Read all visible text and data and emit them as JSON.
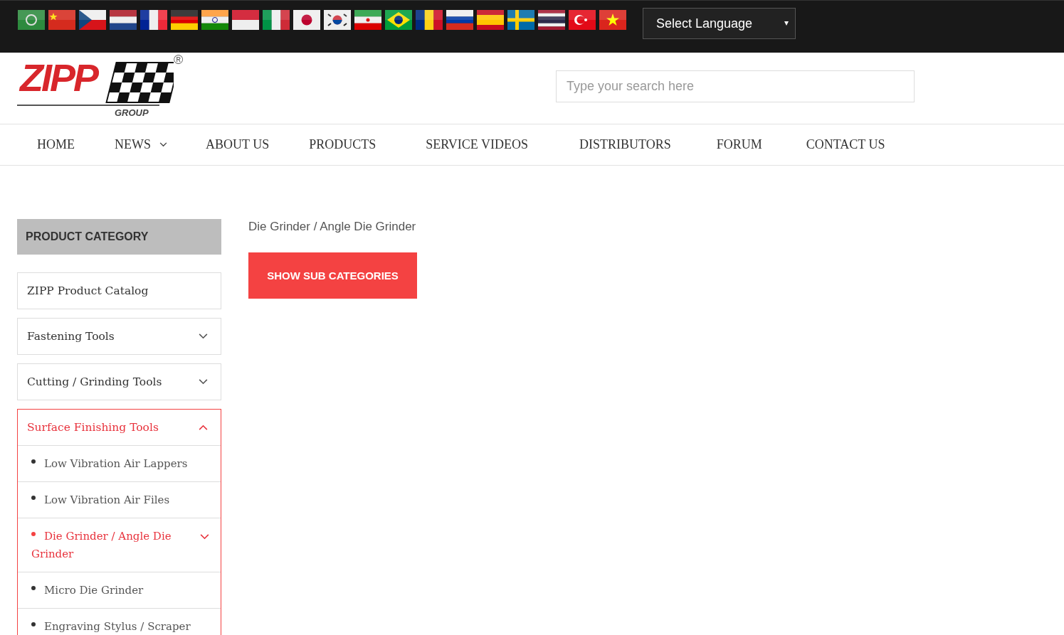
{
  "top_bar": {
    "flags": [
      {
        "kind": "arab"
      },
      {
        "kind": "china"
      },
      {
        "kind": "czech"
      },
      {
        "kind": "netherlands"
      },
      {
        "kind": "france"
      },
      {
        "kind": "germany"
      },
      {
        "kind": "india"
      },
      {
        "kind": "indonesia"
      },
      {
        "kind": "italy"
      },
      {
        "kind": "japan"
      },
      {
        "kind": "korea"
      },
      {
        "kind": "iran"
      },
      {
        "kind": "brazil"
      },
      {
        "kind": "romania"
      },
      {
        "kind": "russia"
      },
      {
        "kind": "spain"
      },
      {
        "kind": "sweden"
      },
      {
        "kind": "thailand"
      },
      {
        "kind": "turkey"
      },
      {
        "kind": "vietnam"
      }
    ],
    "language_select": {
      "value": "Select Language"
    }
  },
  "logo": {
    "wordmark": "ZIPP",
    "subtitle": "GROUP",
    "registered": "®"
  },
  "search": {
    "placeholder": "Type your search here"
  },
  "nav": [
    {
      "label": "HOME",
      "dropdown": false
    },
    {
      "label": "NEWS",
      "dropdown": true
    },
    {
      "label": "ABOUT US",
      "dropdown": false
    },
    {
      "label": "PRODUCTS",
      "dropdown": false
    },
    {
      "label": "SERVICE VIDEOS",
      "dropdown": false
    },
    {
      "label": "DISTRIBUTORS",
      "dropdown": false
    },
    {
      "label": "FORUM",
      "dropdown": false
    },
    {
      "label": "CONTACT US",
      "dropdown": false
    }
  ],
  "sidebar": {
    "heading": "PRODUCT CATEGORY",
    "categories": [
      {
        "label": "ZIPP Product Catalog",
        "kind": "link",
        "selected": false
      },
      {
        "label": "Fastening Tools",
        "kind": "folder",
        "expanded": false,
        "selected": false
      },
      {
        "label": "Cutting / Grinding Tools",
        "kind": "folder",
        "expanded": false,
        "selected": false
      },
      {
        "label": "Surface Finishing Tools",
        "kind": "folder",
        "expanded": true,
        "selected": true,
        "children": [
          {
            "label": "Low Vibration Air Lappers",
            "kind": "link",
            "selected": false
          },
          {
            "label": "Low Vibration Air Files",
            "kind": "link",
            "selected": false
          },
          {
            "label": "Die Grinder / Angle Die Grinder",
            "kind": "folder",
            "expanded": false,
            "selected": true
          },
          {
            "label": "Micro Die Grinder",
            "kind": "link",
            "selected": false
          },
          {
            "label": "Engraving Stylus / Scraper",
            "kind": "link",
            "selected": false
          }
        ]
      }
    ]
  },
  "main": {
    "breadcrumb": "Die Grinder / Angle Die Grinder",
    "button": "SHOW SUB CATEGORIES"
  }
}
